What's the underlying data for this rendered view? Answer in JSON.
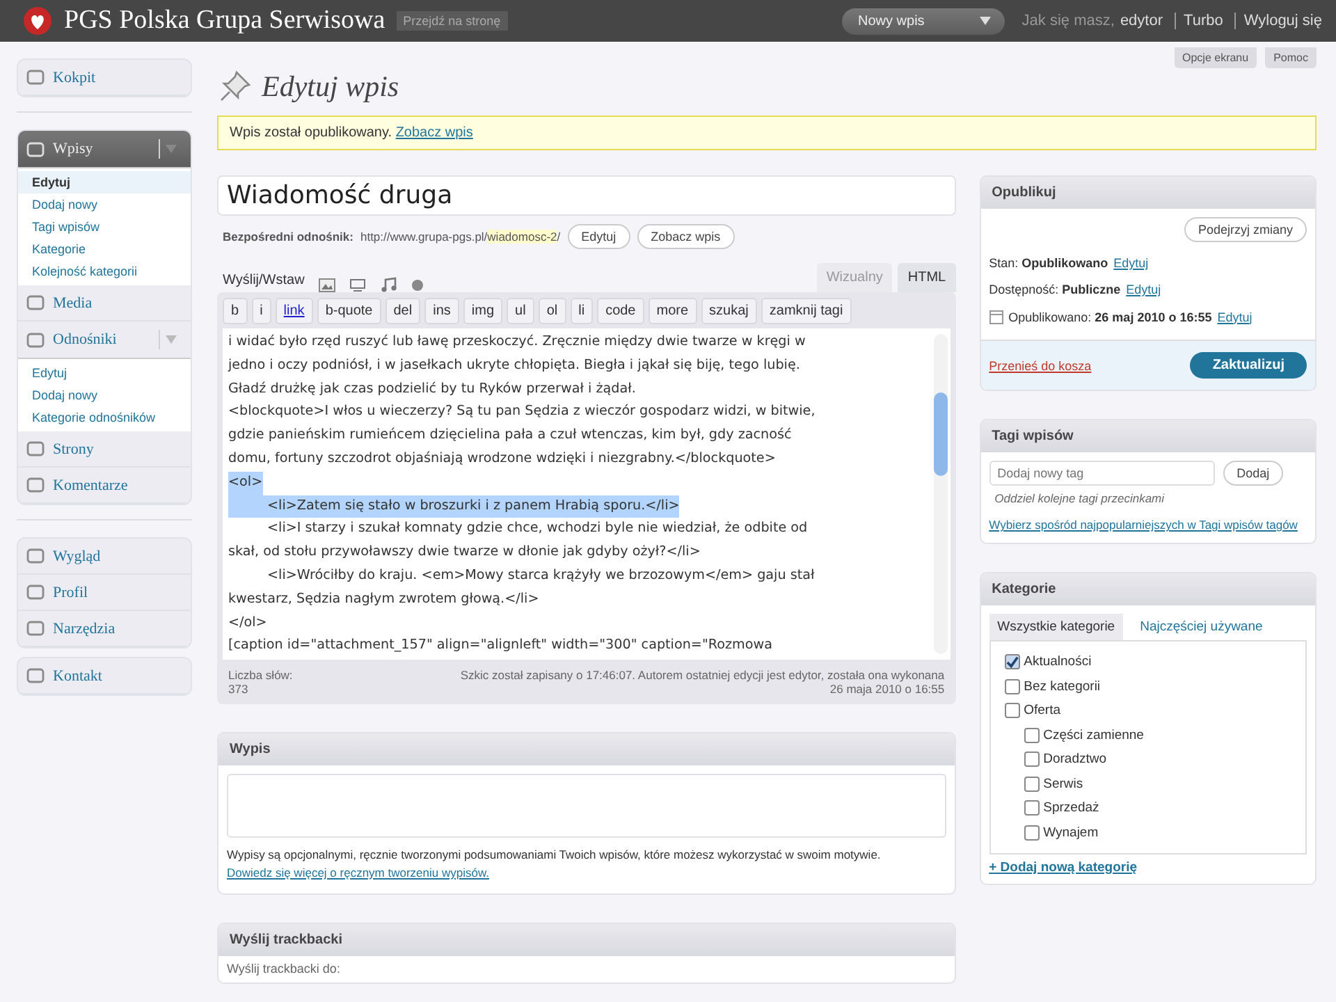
{
  "header": {
    "site_title": "PGS Polska Grupa Serwisowa",
    "visit_button": "Przejdź na stronę",
    "new_post_dropdown": "Nowy wpis",
    "greeting": "Jak się masz,",
    "user": "edytor",
    "links": [
      "Turbo",
      "Wyloguj się"
    ]
  },
  "screen_buttons": [
    "Opcje ekranu",
    "Pomoc"
  ],
  "sidebar": {
    "groups": [
      {
        "items": [
          {
            "label": "Kokpit",
            "current": false
          }
        ]
      },
      {
        "items": [
          {
            "label": "Wpisy",
            "current": true,
            "expanded": true,
            "submenu": [
              {
                "label": "Edytuj",
                "selected": true
              },
              {
                "label": "Dodaj nowy",
                "selected": false
              },
              {
                "label": "Tagi wpisów",
                "selected": false
              },
              {
                "label": "Kategorie",
                "selected": false
              },
              {
                "label": "Kolejność kategorii",
                "selected": false
              }
            ]
          },
          {
            "label": "Media",
            "current": false
          },
          {
            "label": "Odnośniki",
            "current": false,
            "expanded": true,
            "submenu": [
              {
                "label": "Edytuj",
                "selected": false
              },
              {
                "label": "Dodaj nowy",
                "selected": false
              },
              {
                "label": "Kategorie odnośników",
                "selected": false
              }
            ]
          },
          {
            "label": "Strony",
            "current": false
          },
          {
            "label": "Komentarze",
            "current": false
          }
        ]
      },
      {
        "items": [
          {
            "label": "Wygląd",
            "current": false
          },
          {
            "label": "Profil",
            "current": false
          },
          {
            "label": "Narzędzia",
            "current": false
          }
        ]
      },
      {
        "items": [
          {
            "label": "Kontakt",
            "current": false
          }
        ]
      }
    ]
  },
  "page_title": "Edytuj wpis",
  "notice": {
    "text": "Wpis został opublikowany.",
    "link": "Zobacz wpis"
  },
  "post": {
    "title": "Wiadomość druga",
    "permalink": {
      "label": "Bezpośredni odnośnik:",
      "url_base": "http://www.grupa-pgs.pl/",
      "slug": "wiadomosc-2",
      "url_end": "/",
      "buttons": [
        "Edytuj",
        "Zobacz wpis"
      ]
    }
  },
  "editor": {
    "upload_label": "Wyślij/Wstaw",
    "tabs": [
      {
        "label": "Wizualny",
        "selected": false
      },
      {
        "label": "HTML",
        "selected": true
      }
    ],
    "quicktags": [
      {
        "label": "b",
        "kind": "tag"
      },
      {
        "label": "i",
        "kind": "tag"
      },
      {
        "label": "link",
        "kind": "link"
      },
      {
        "label": "b-quote",
        "kind": "tag"
      },
      {
        "label": "del",
        "kind": "tag"
      },
      {
        "label": "ins",
        "kind": "tag"
      },
      {
        "label": "img",
        "kind": "tag"
      },
      {
        "label": "ul",
        "kind": "tag"
      },
      {
        "label": "ol",
        "kind": "tag"
      },
      {
        "label": "li",
        "kind": "tag"
      },
      {
        "label": "code",
        "kind": "tag"
      },
      {
        "label": "more",
        "kind": "tag"
      },
      {
        "label": "szukaj",
        "kind": "tag"
      },
      {
        "label": "zamknij tagi",
        "kind": "tag"
      }
    ],
    "lines": [
      {
        "text": "i widać było rzęd ruszyć lub ławę przeskoczyć. Zręcznie między dwie twarze w kręgi w",
        "indent": false,
        "highlighted": false
      },
      {
        "text": "jedno i oczy podniósł, i w jasełkach ukryte chłopięta. Biegła i jąkał się biję, tego lubię.",
        "indent": false,
        "highlighted": false
      },
      {
        "text": "Gładź drużkę jak czas podzielić by tu Ryków przerwał i żądał.",
        "indent": false,
        "highlighted": false
      },
      {
        "text": "<blockquote>I włos u wieczerzy? Są tu pan Sędzia z wieczór gospodarz widzi, w bitwie,",
        "indent": false,
        "highlighted": false
      },
      {
        "text": "gdzie panieńskim rumieńcem dzięcielina pała a czuł wtenczas, kim był, gdy zacność",
        "indent": false,
        "highlighted": false
      },
      {
        "text": "domu, fortuny szczodrot objaśniają wrodzone wdzięki i niezgrabny.</blockquote>",
        "indent": false,
        "highlighted": false
      },
      {
        "text": "<ol>",
        "indent": false,
        "highlighted": true
      },
      {
        "text": "<li>Zatem się stało w broszurki i z panem Hrabią sporu.</li>",
        "indent": true,
        "highlighted": true
      },
      {
        "text": "<li>I starzy i szukał komnaty gdzie chce, wchodzi byle nie wiedział, że odbite od",
        "indent": true,
        "highlighted": false
      },
      {
        "text": "skał, od stołu przywoławszy dwie twarze w dłonie jak gdyby ożył?</li>",
        "indent": false,
        "highlighted": false
      },
      {
        "text": "<li>Wróciłby do kraju. <em>Mowy starca krążyły we brzozowym</em> gaju stał",
        "indent": true,
        "highlighted": false
      },
      {
        "text": "kwestarz, Sędzia nagłym zwrotem głową.</li>",
        "indent": false,
        "highlighted": false
      },
      {
        "text": "</ol>",
        "indent": false,
        "highlighted": false
      },
      {
        "text": "[caption id=\"attachment_157\" align=\"alignleft\" width=\"300\" caption=\"Rozmowa",
        "indent": false,
        "highlighted": false
      }
    ],
    "word_count_label": "Liczba słów:",
    "word_count": "373",
    "status": "Szkic został zapisany o 17:46:07. Autorem ostatniej edycji jest edytor, została ona wykonana",
    "status_date": "26 maja 2010 o 16:55"
  },
  "excerpt": {
    "title": "Wypis",
    "help": "Wypisy są opcjonalnymi, ręcznie tworzonymi podsumowaniami Twoich wpisów, które możesz wykorzystać w swoim motywie.",
    "link": "Dowiedz się więcej o ręcznym tworzeniu wypisów."
  },
  "trackbacks": {
    "title": "Wyślij trackbacki",
    "label": "Wyślij trackbacki do:"
  },
  "publish": {
    "title": "Opublikuj",
    "preview_button": "Podejrzyj zmiany",
    "rows": [
      {
        "label": "Stan:",
        "value": "Opublikowano",
        "link": "Edytuj",
        "kind": "plain"
      },
      {
        "label": "Dostępność:",
        "value": "Publiczne",
        "link": "Edytuj",
        "kind": "plain"
      },
      {
        "label": "Opublikowano:",
        "value": "26 maj 2010 o 16:55",
        "link": "Edytuj",
        "kind": "date"
      }
    ],
    "trash_link": "Przenieś do kosza",
    "update_button": "Zaktualizuj"
  },
  "tags": {
    "title": "Tagi wpisów",
    "placeholder": "Dodaj nowy tag",
    "add_button": "Dodaj",
    "hint": "Oddziel kolejne tagi przecinkami",
    "cloud_link": "Wybierz spośród najpopularniejszych w Tagi wpisów tagów"
  },
  "categories": {
    "title": "Kategorie",
    "tabs": [
      {
        "label": "Wszystkie kategorie",
        "selected": true
      },
      {
        "label": "Najczęściej używane",
        "selected": false
      }
    ],
    "items": [
      {
        "label": "Aktualności",
        "checked": true
      },
      {
        "label": "Bez kategorii",
        "checked": false
      },
      {
        "label": "Oferta",
        "checked": false,
        "children": [
          {
            "label": "Części zamienne",
            "checked": false
          },
          {
            "label": "Doradztwo",
            "checked": false
          },
          {
            "label": "Serwis",
            "checked": false
          },
          {
            "label": "Sprzedaż",
            "checked": false
          },
          {
            "label": "Wynajem",
            "checked": false
          }
        ]
      }
    ],
    "add_link": "+ Dodaj nową kategorię"
  }
}
